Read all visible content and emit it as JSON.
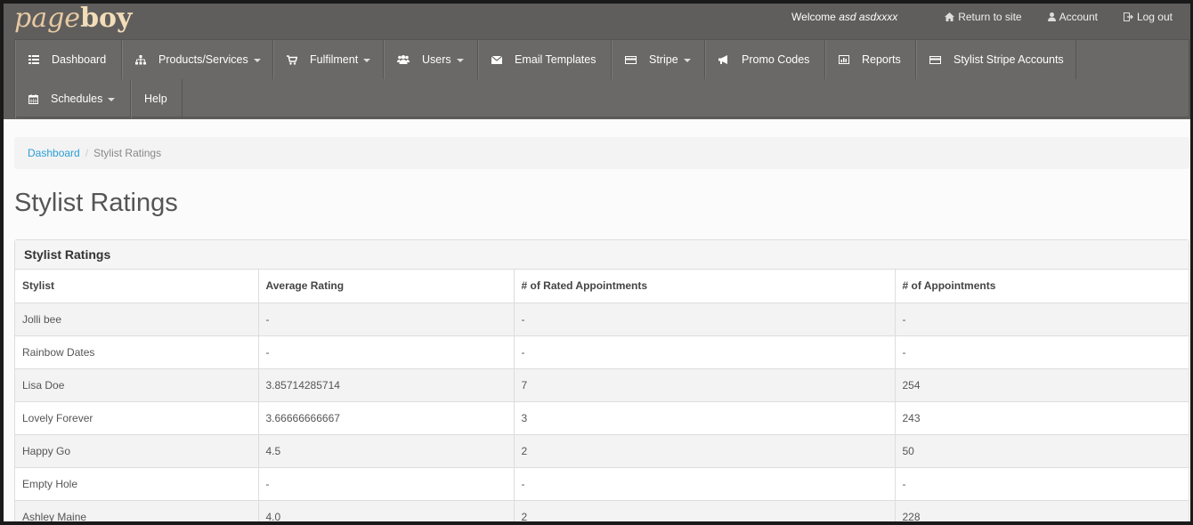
{
  "logo": {
    "part1": "page",
    "part2": "boy"
  },
  "topbar": {
    "welcome_prefix": "Welcome",
    "welcome_user": "asd asdxxxx",
    "return_label": "Return to site",
    "account_label": "Account",
    "logout_label": "Log out"
  },
  "nav": {
    "dashboard": "Dashboard",
    "products": "Products/Services",
    "fulfilment": "Fulfilment",
    "users": "Users",
    "email_templates": "Email Templates",
    "stripe": "Stripe",
    "promo_codes": "Promo Codes",
    "reports": "Reports",
    "stylist_stripe": "Stylist Stripe Accounts",
    "schedules": "Schedules",
    "help": "Help"
  },
  "breadcrumb": {
    "home": "Dashboard",
    "separator": "/",
    "current": "Stylist Ratings"
  },
  "page_title": "Stylist Ratings",
  "panel": {
    "heading": "Stylist Ratings",
    "columns": [
      "Stylist",
      "Average Rating",
      "# of Rated Appointments",
      "# of Appointments"
    ],
    "rows": [
      [
        "Jolli bee",
        "-",
        "-",
        "-"
      ],
      [
        "Rainbow Dates",
        "-",
        "-",
        "-"
      ],
      [
        "Lisa Doe",
        "3.85714285714",
        "7",
        "254"
      ],
      [
        "Lovely Forever",
        "3.66666666667",
        "3",
        "243"
      ],
      [
        "Happy Go",
        "4.5",
        "2",
        "50"
      ],
      [
        "Empty Hole",
        "-",
        "-",
        "-"
      ],
      [
        "Ashley Maine",
        "4.0",
        "2",
        "228"
      ]
    ]
  },
  "colors": {
    "topbar": "#5f5e5c",
    "nav": "#6a6967",
    "link": "#2a9fd6",
    "logo": "#e8c9a3"
  }
}
